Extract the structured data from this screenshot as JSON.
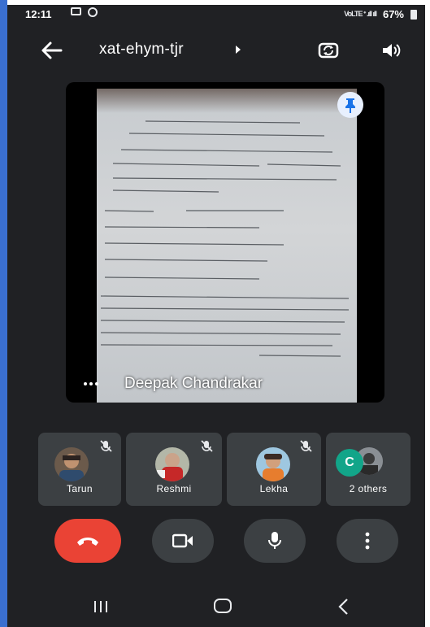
{
  "status_bar": {
    "time": "12:11",
    "signal_text": "VoLTE ᐩ .ıll ıll",
    "battery": "67%"
  },
  "top_bar": {
    "meeting_code": "xat-ehym-tjr"
  },
  "main_video": {
    "speaker_name": "Deepak Chandrakar"
  },
  "participants": [
    {
      "name": "Tarun",
      "muted": true
    },
    {
      "name": "Reshmi",
      "muted": true
    },
    {
      "name": "Lekha",
      "muted": true
    },
    {
      "name": "2 others",
      "initial": "C"
    }
  ],
  "colors": {
    "background": "#202124",
    "tile": "#3c4043",
    "end_call": "#ea4335",
    "c_avatar": "#12a589",
    "pin_bg": "#e8f0fe",
    "pin_icon": "#1a73e8"
  },
  "icons": {
    "back": "arrow-left-icon",
    "switch_camera": "switch-camera-icon",
    "speaker": "speaker-icon",
    "pin": "pin-icon",
    "end_call": "phone-hangup-icon",
    "camera": "video-camera-icon",
    "mic": "microphone-icon",
    "more": "more-vertical-icon"
  }
}
